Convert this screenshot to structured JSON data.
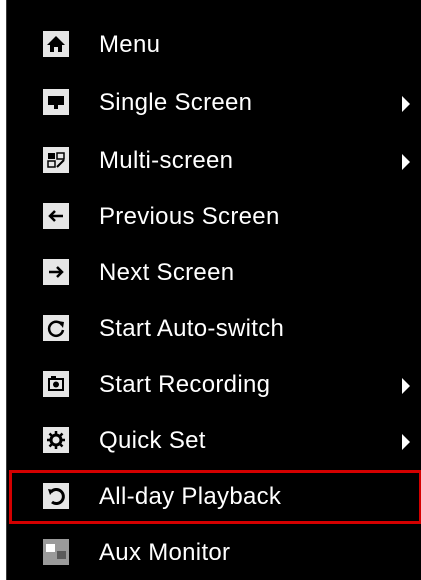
{
  "menu": {
    "items": [
      {
        "label": "Menu",
        "icon": "home-icon",
        "has_submenu": false,
        "highlighted": false
      },
      {
        "label": "Single Screen",
        "icon": "single-screen-icon",
        "has_submenu": true,
        "highlighted": false
      },
      {
        "label": "Multi-screen",
        "icon": "multi-screen-icon",
        "has_submenu": true,
        "highlighted": false
      },
      {
        "label": "Previous Screen",
        "icon": "arrow-left-icon",
        "has_submenu": false,
        "highlighted": false
      },
      {
        "label": "Next Screen",
        "icon": "arrow-right-icon",
        "has_submenu": false,
        "highlighted": false
      },
      {
        "label": "Start Auto-switch",
        "icon": "refresh-icon",
        "has_submenu": false,
        "highlighted": false
      },
      {
        "label": "Start Recording",
        "icon": "record-icon",
        "has_submenu": true,
        "highlighted": false
      },
      {
        "label": "Quick Set",
        "icon": "gear-icon",
        "has_submenu": true,
        "highlighted": false
      },
      {
        "label": "All-day Playback",
        "icon": "playback-icon",
        "has_submenu": false,
        "highlighted": true
      },
      {
        "label": "Aux Monitor",
        "icon": "aux-monitor-icon",
        "has_submenu": false,
        "highlighted": false
      }
    ]
  },
  "colors": {
    "background": "#000000",
    "text": "#ffffff",
    "icon_tile": "#e6e6e6",
    "highlight_border": "#d40000"
  }
}
